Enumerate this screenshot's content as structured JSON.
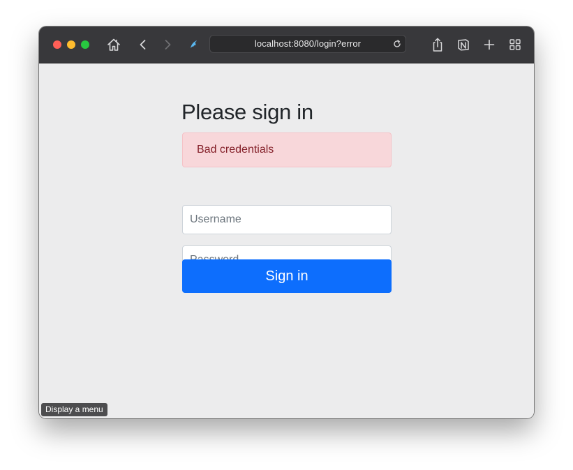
{
  "browser": {
    "url": "localhost:8080/login?error",
    "icons": {
      "close": "close-window-icon",
      "minimize": "minimize-window-icon",
      "zoom": "zoom-window-icon",
      "home": "home-icon",
      "back": "chevron-left-icon",
      "forward": "chevron-right-icon",
      "extension": "bird-extension-icon",
      "reload": "reload-icon",
      "share": "share-icon",
      "notion": "notion-icon",
      "new_tab": "plus-icon",
      "tab_overview": "grid-icon"
    },
    "colors": {
      "close": "#ff5f57",
      "minimize": "#febc2e",
      "zoom": "#28c840",
      "toolbar": "#38383b"
    }
  },
  "page": {
    "heading": "Please sign in",
    "alert": "Bad credentials",
    "username_placeholder": "Username",
    "password_placeholder": "Password",
    "submit_label": "Sign in",
    "colors": {
      "primary": "#0d6efd",
      "alert_bg": "#f8d7da",
      "alert_text": "#842029"
    }
  },
  "tooltip": "Display a menu"
}
